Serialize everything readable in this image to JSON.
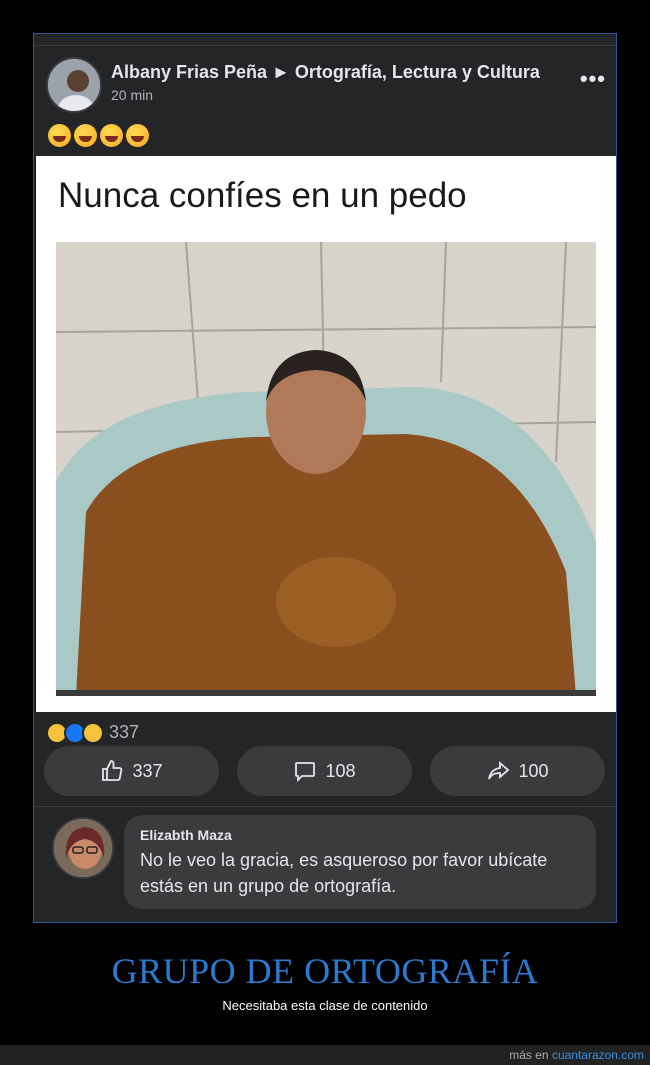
{
  "post": {
    "author": "Albany Frias Peña ► Ortografía, Lectura y Cultura",
    "time": "20 min",
    "more_icon": "more-dots-icon",
    "emoji_text": [
      "rofl-emoji",
      "rofl-emoji",
      "rofl-emoji",
      "rofl-emoji"
    ]
  },
  "meme": {
    "caption": "Nunca confíes en un pedo"
  },
  "reactions": {
    "icons": [
      "laugh-reaction-icon",
      "like-reaction-icon",
      "wow-reaction-icon"
    ],
    "count": "337"
  },
  "actions": {
    "like_count": "337",
    "comment_count": "108",
    "share_count": "100"
  },
  "comment": {
    "name": "Elizabth Maza",
    "text": "No le veo la gracia, es asqueroso por favor ubícate estás en un grupo de ortografía."
  },
  "site": {
    "headline": "GRUPO DE ORTOGRAFÍA",
    "subtitle": "Necesitaba esta clase de contenido",
    "footer_prefix": "más en ",
    "footer_link": "cuantarazon.com"
  },
  "colors": {
    "accent": "#2a7ad0",
    "card": "#242526",
    "bubble": "#3a3b3c"
  }
}
